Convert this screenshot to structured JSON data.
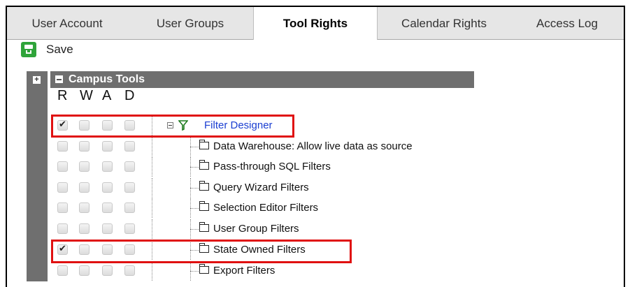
{
  "tabs": [
    {
      "label": "User Account",
      "active": false
    },
    {
      "label": "User Groups",
      "active": false
    },
    {
      "label": "Tool Rights",
      "active": true
    },
    {
      "label": "Calendar Rights",
      "active": false
    },
    {
      "label": "Access Log",
      "active": false
    }
  ],
  "toolbar": {
    "save_label": "Save",
    "save_icon": "save-icon"
  },
  "tree": {
    "root_label": "Campus Tools",
    "columns": {
      "r": "R",
      "w": "W",
      "a": "A",
      "d": "D"
    },
    "parent": {
      "label": "Filter Designer",
      "icon": "filter-icon",
      "rights": {
        "r": true,
        "w": false,
        "a": false,
        "d": false
      }
    },
    "children": [
      {
        "label": "Data Warehouse: Allow live data as source",
        "rights": {
          "r": false,
          "w": false,
          "a": false,
          "d": false
        }
      },
      {
        "label": "Pass-through SQL Filters",
        "rights": {
          "r": false,
          "w": false,
          "a": false,
          "d": false
        }
      },
      {
        "label": "Query Wizard Filters",
        "rights": {
          "r": false,
          "w": false,
          "a": false,
          "d": false
        }
      },
      {
        "label": "Selection Editor Filters",
        "rights": {
          "r": false,
          "w": false,
          "a": false,
          "d": false
        }
      },
      {
        "label": "User Group Filters",
        "rights": {
          "r": false,
          "w": false,
          "a": false,
          "d": false
        }
      },
      {
        "label": "State Owned Filters",
        "rights": {
          "r": true,
          "w": false,
          "a": false,
          "d": false
        }
      },
      {
        "label": "Export Filters",
        "rights": {
          "r": false,
          "w": false,
          "a": false,
          "d": false
        }
      }
    ]
  },
  "colors": {
    "highlight": "#e01010",
    "header_bg": "#6f6f6f",
    "link": "#1a3ed1",
    "save_green": "#2fa43a"
  }
}
